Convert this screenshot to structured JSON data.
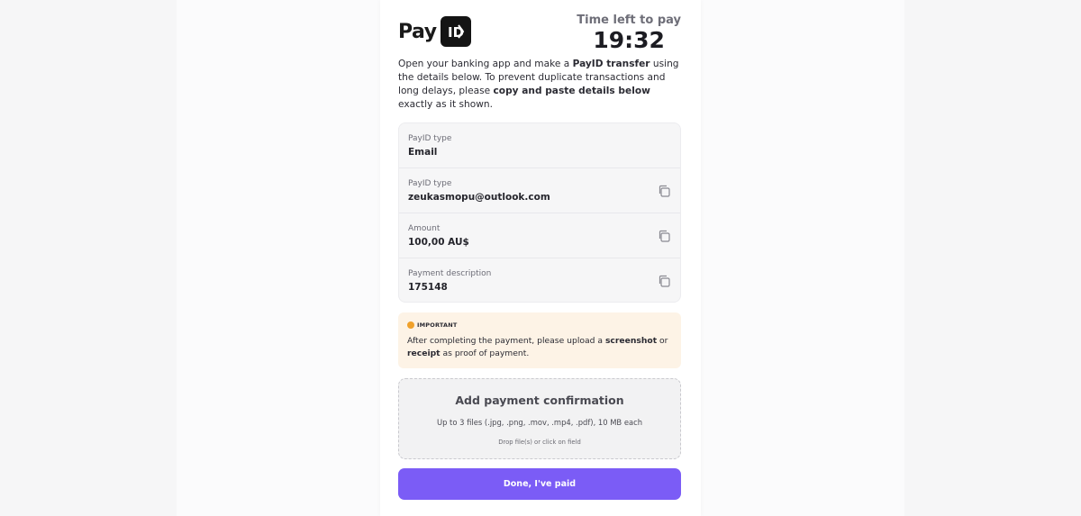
{
  "brand": {
    "word": "Pay",
    "badge": "ID"
  },
  "timer": {
    "label": "Time left to pay",
    "value": "19:32"
  },
  "intro": {
    "p1": "Open your banking app and make a ",
    "b1": "PayID transfer",
    "p2": " using the details below. To prevent duplicate transactions and long delays, please ",
    "b2": "copy and paste details below",
    "p3": " exactly as it shown."
  },
  "details": [
    {
      "label": "PayID type",
      "value": "Email"
    },
    {
      "label": "PayID type",
      "value": "zeukasmopu@outlook.com"
    },
    {
      "label": "Amount",
      "value": "100,00 AU$"
    },
    {
      "label": "Payment description",
      "value": "175148"
    }
  ],
  "notice": {
    "title": "IMPORTANT",
    "p1": "After completing the payment, please upload a ",
    "b1": "screenshot",
    "p2": " or ",
    "b2": "receipt",
    "p3": " as proof of payment.",
    "accent": "#f0a12b"
  },
  "upload": {
    "title": "Add payment confirmation",
    "hint": "Up to 3 files (.jpg, .png, .mov, .mp4, .pdf), 10 MB each",
    "sub": "Drop file(s) or click on field"
  },
  "button": {
    "label": "Done, I've paid",
    "color": "#7b5cf6"
  },
  "icons": {
    "copy": "copy-icon",
    "warning": "warning-icon"
  }
}
